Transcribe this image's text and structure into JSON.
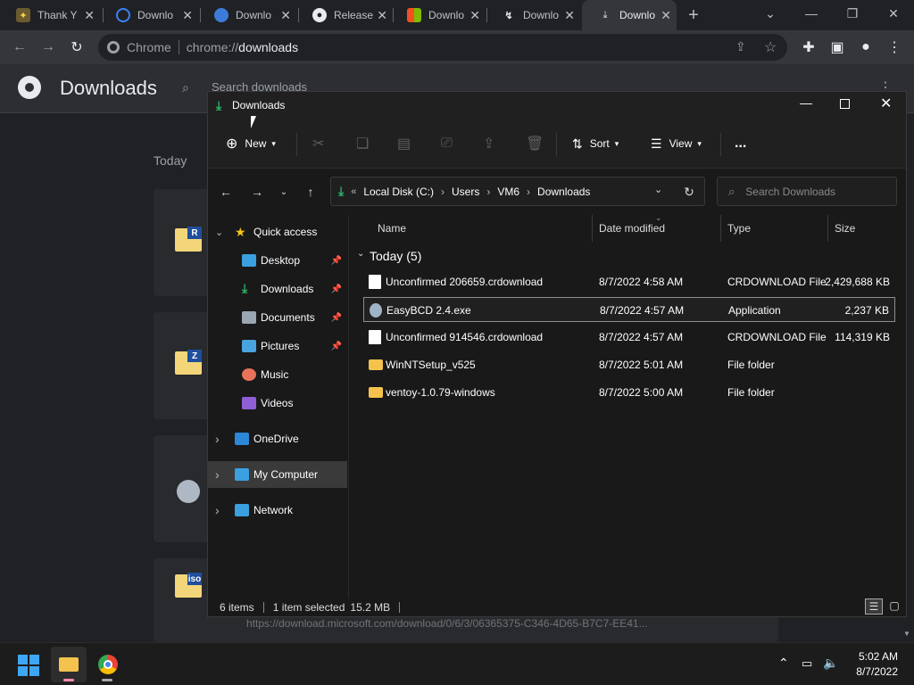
{
  "chrome": {
    "tabs": [
      {
        "label": "Thank Y",
        "icon": "ventoy-icon"
      },
      {
        "label": "Downlo",
        "icon": "edge-icon"
      },
      {
        "label": "Downlo",
        "icon": "easybcd-icon"
      },
      {
        "label": "Release",
        "icon": "github-icon"
      },
      {
        "label": "Downlo",
        "icon": "microsoft-icon"
      },
      {
        "label": "Downlo",
        "icon": "winntsetup-icon"
      },
      {
        "label": "Downlo",
        "icon": "download-icon"
      }
    ],
    "omnibox": {
      "site": "Chrome",
      "url_prefix": "chrome://",
      "url_path": "downloads"
    }
  },
  "downloads_page": {
    "title": "Downloads",
    "search_placeholder": "Search downloads",
    "section": "Today",
    "icons": [
      {
        "badge": "R"
      },
      {
        "badge": "Z"
      },
      {
        "badge": ""
      },
      {
        "badge": "iso"
      }
    ],
    "url_fragment": "https://download.microsoft.com/download/0/6/3/06365375-C346-4D65-B7C7-EE41..."
  },
  "explorer": {
    "title": "Downloads",
    "commands": {
      "new": "New",
      "sort": "Sort",
      "view": "View",
      "more": "..."
    },
    "breadcrumb": [
      "Local Disk (C:)",
      "Users",
      "VM6",
      "Downloads"
    ],
    "search_placeholder": "Search Downloads",
    "nav": [
      {
        "label": "Quick access",
        "icon": "star-icon",
        "color": "#f5c518",
        "expandable": true,
        "level": 0,
        "pinned": false
      },
      {
        "label": "Desktop",
        "icon": "desktop-icon",
        "color": "#3aa0e0",
        "expandable": false,
        "level": 1,
        "pinned": true
      },
      {
        "label": "Downloads",
        "icon": "download-icon",
        "color": "#2fb36b",
        "expandable": false,
        "level": 1,
        "pinned": true
      },
      {
        "label": "Documents",
        "icon": "documents-icon",
        "color": "#9aa6b2",
        "expandable": false,
        "level": 1,
        "pinned": true
      },
      {
        "label": "Pictures",
        "icon": "pictures-icon",
        "color": "#4aa3df",
        "expandable": false,
        "level": 1,
        "pinned": true
      },
      {
        "label": "Music",
        "icon": "music-icon",
        "color": "#e8735a",
        "expandable": false,
        "level": 1,
        "pinned": false
      },
      {
        "label": "Videos",
        "icon": "videos-icon",
        "color": "#8e5fd6",
        "expandable": false,
        "level": 1,
        "pinned": false
      },
      {
        "label": "OneDrive",
        "icon": "onedrive-icon",
        "color": "#2b88d8",
        "expandable": true,
        "level": 0,
        "pinned": false
      },
      {
        "label": "My Computer",
        "icon": "computer-icon",
        "color": "#3aa0e0",
        "expandable": true,
        "level": 0,
        "pinned": false
      },
      {
        "label": "Network",
        "icon": "network-icon",
        "color": "#3aa0e0",
        "expandable": true,
        "level": 0,
        "pinned": false
      }
    ],
    "columns": {
      "name": "Name",
      "date": "Date modified",
      "type": "Type",
      "size": "Size"
    },
    "group": "Today (5)",
    "files": [
      {
        "name": "Unconfirmed 206659.crdownload",
        "date": "8/7/2022 4:58 AM",
        "type": "CRDOWNLOAD File",
        "size": "2,429,688 KB",
        "kind": "doc"
      },
      {
        "name": "EasyBCD 2.4.exe",
        "date": "8/7/2022 4:57 AM",
        "type": "Application",
        "size": "2,237 KB",
        "kind": "app"
      },
      {
        "name": "Unconfirmed 914546.crdownload",
        "date": "8/7/2022 4:57 AM",
        "type": "CRDOWNLOAD File",
        "size": "114,319 KB",
        "kind": "doc"
      },
      {
        "name": "WinNTSetup_v525",
        "date": "8/7/2022 5:01 AM",
        "type": "File folder",
        "size": "",
        "kind": "folder"
      },
      {
        "name": "ventoy-1.0.79-windows",
        "date": "8/7/2022 5:00 AM",
        "type": "File folder",
        "size": "",
        "kind": "folder"
      }
    ],
    "selected_row": 1,
    "status": {
      "items": "6 items",
      "selected": "1 item selected",
      "size": "15.2 MB"
    }
  },
  "taskbar": {
    "time": "5:02 AM",
    "date": "8/7/2022"
  }
}
